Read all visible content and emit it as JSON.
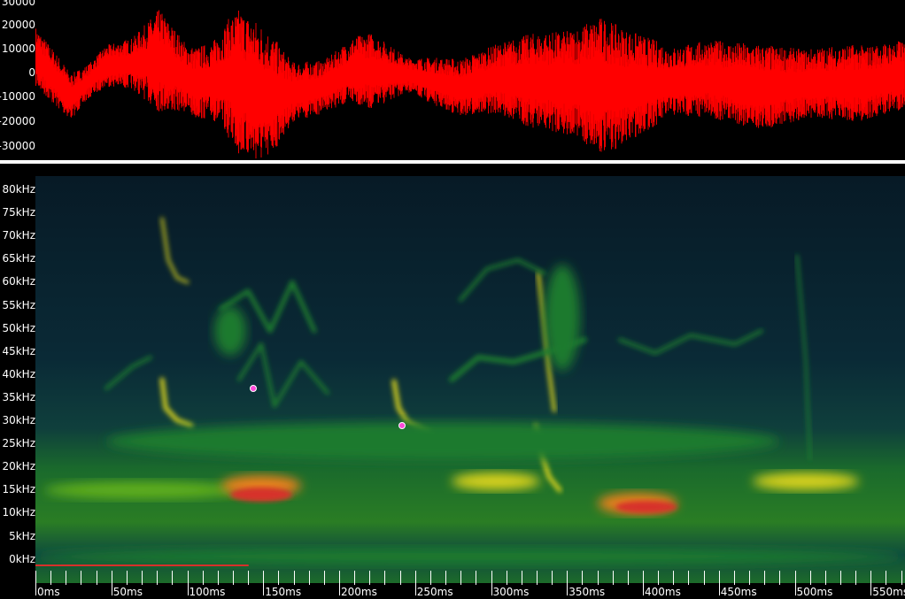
{
  "waveform": {
    "color": "#ff0000",
    "y_ticks": [
      "30000",
      "20000",
      "10000",
      "0",
      "-10000",
      "-20000",
      "-30000"
    ]
  },
  "spectrogram": {
    "colormap": [
      "#06131f",
      "#0b2a3a",
      "#0f4a3e",
      "#1d7a2e",
      "#5fae1e",
      "#d8d21c",
      "#e9801a",
      "#d7302a"
    ],
    "freq_ticks": [
      "80kHz",
      "75kHz",
      "70kHz",
      "65kHz",
      "60kHz",
      "55kHz",
      "50kHz",
      "45kHz",
      "40kHz",
      "35kHz",
      "30kHz",
      "25kHz",
      "20kHz",
      "15kHz",
      "10kHz",
      "5kHz",
      "0kHz"
    ]
  },
  "time_axis": {
    "labels": [
      "0ms",
      "50ms",
      "100ms",
      "150ms",
      "200ms",
      "250ms",
      "300ms",
      "350ms",
      "400ms",
      "450ms",
      "500ms",
      "550ms"
    ]
  }
}
